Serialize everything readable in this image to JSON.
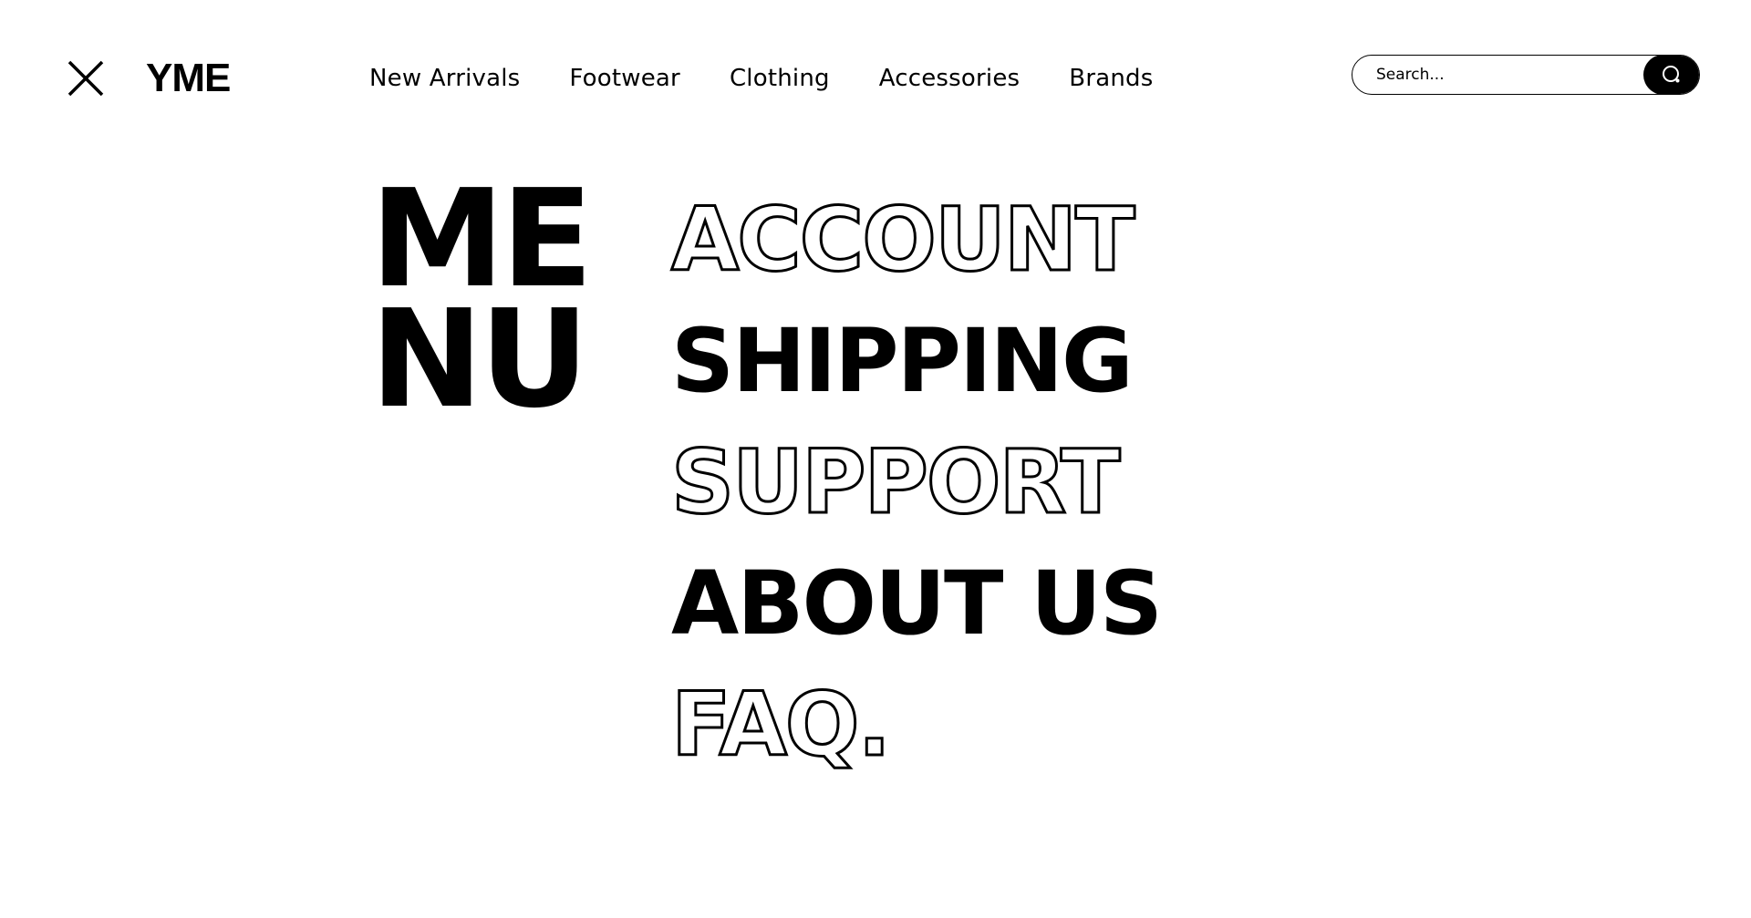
{
  "header": {
    "logo": "YME",
    "nav": [
      {
        "label": "New Arrivals"
      },
      {
        "label": "Footwear"
      },
      {
        "label": "Clothing"
      },
      {
        "label": "Accessories"
      },
      {
        "label": "Brands"
      }
    ],
    "search": {
      "placeholder": "Search...",
      "value": ""
    }
  },
  "menu": {
    "title_line1": "ME",
    "title_line2": "NU",
    "items": [
      {
        "label": "ACCOUNT",
        "style": "outline"
      },
      {
        "label": "SHIPPING",
        "style": "solid"
      },
      {
        "label": "SUPPORT",
        "style": "outline"
      },
      {
        "label": "ABOUT US",
        "style": "solid"
      },
      {
        "label": "FAQ.",
        "style": "outline"
      }
    ]
  },
  "colors": {
    "background": "#ffffff",
    "foreground": "#000000"
  },
  "icons": {
    "close": "close-icon",
    "search": "search-icon"
  }
}
